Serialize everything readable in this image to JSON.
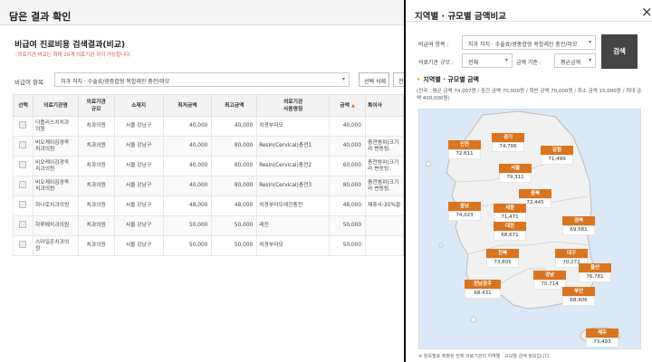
{
  "left": {
    "title": "담은 결과 확인",
    "close": "×",
    "section_title": "비급여 진료비용 검색결과(비교)",
    "note": "· 의료기관 비교는 최대 20개 의료기관 까지 가능합니다.",
    "filter_label": "비급여 항목",
    "filter_value": "치과 처치 · 수술료/광중합형 복합레진 충전/마모",
    "btn_delete": "선택 삭제",
    "btn_cut": "전",
    "columns": [
      "선택",
      "의료기관명",
      "의료기관\n규모",
      "소재지",
      "최저금액",
      "최고금액",
      "의료기관\n사용명칭",
      "금액",
      "특이사"
    ],
    "sort_icon": "▲",
    "rows": [
      {
        "name": "더플러스치치과\n의원",
        "scale": "치과의원",
        "loc": "서울 강남구",
        "min": "40,000",
        "max": "40,000",
        "usage": "치경부마모",
        "amount": "40,000",
        "remark": ""
      },
      {
        "name": "비오케이김광욱\n치과의원",
        "scale": "치과의원",
        "loc": "서울 강남구",
        "min": "40,000",
        "max": "80,000",
        "usage": "Resin(Cervical)충전1",
        "amount": "40,000",
        "remark": "충전범위(크기\n라 변동됨."
      },
      {
        "name": "비오케이김광욱\n치과의원",
        "scale": "치과의원",
        "loc": "서울 강남구",
        "min": "40,000",
        "max": "80,000",
        "usage": "Resin(Cervical)충전2",
        "amount": "60,000",
        "remark": "충전범위(크기\n라 변동됨."
      },
      {
        "name": "비오케이김광욱\n치과의원",
        "scale": "치과의원",
        "loc": "서울 강남구",
        "min": "40,000",
        "max": "80,000",
        "usage": "Resin(Cervical)충전3",
        "amount": "80,000",
        "remark": "충전범위(크기\n라 변동됨."
      },
      {
        "name": "하나로치과의원",
        "scale": "치과의원",
        "loc": "서울 강남구",
        "min": "48,000",
        "max": "48,000",
        "usage": "치경부마모레진충전",
        "amount": "48,000",
        "remark": "제휴사-20%할"
      },
      {
        "name": "하루에치과의원",
        "scale": "치과의원",
        "loc": "서울 강남구",
        "min": "50,000",
        "max": "50,000",
        "usage": "레진",
        "amount": "50,000",
        "remark": ""
      },
      {
        "name": "스마일존치과의\n원",
        "scale": "치과의원",
        "loc": "서울 강남구",
        "min": "50,000",
        "max": "50,000",
        "usage": "치경부마모",
        "amount": "50,000",
        "remark": ""
      }
    ]
  },
  "right": {
    "title": "지역별 · 규모별 금액비교",
    "close": "×",
    "item_label": "비급여 항목 :",
    "item_value": "치과 처치 · 수술료/광중합형 복합레진 충전/마모",
    "scale_label": "의료기관 규모 :",
    "scale_value": "전체",
    "amount_label": "금액 기준 :",
    "amount_value": "평균금액",
    "search": "검색",
    "sub_title": "지역별 · 규모별 금액",
    "desc": "(전국 : 평균 금액 74,007원 / 중간 금액 70,000원 / 최빈 금액 70,000원 / 최소 금액 15,000원 / 최대 금액 400,000원)",
    "regions": [
      {
        "name": "인천",
        "value": "72,611"
      },
      {
        "name": "경기",
        "value": "74,706"
      },
      {
        "name": "강원",
        "value": "71,499"
      },
      {
        "name": "서울",
        "value": "79,311"
      },
      {
        "name": "충북",
        "value": "72,445"
      },
      {
        "name": "충남",
        "value": "74,023"
      },
      {
        "name": "세종",
        "value": "71,471"
      },
      {
        "name": "대전",
        "value": "68,671"
      },
      {
        "name": "경북",
        "value": "69,581"
      },
      {
        "name": "대구",
        "value": "70,272"
      },
      {
        "name": "전북",
        "value": "73,805"
      },
      {
        "name": "울산",
        "value": "76,781"
      },
      {
        "name": "경남",
        "value": "70,714"
      },
      {
        "name": "전남광주",
        "value": "68,431"
      },
      {
        "name": "부산",
        "value": "68,406"
      },
      {
        "name": "제주",
        "value": "73,493"
      }
    ],
    "footnote": "※ 항목별로 제출된 전체 의료기관의 지역별 · 규모별 금액 정보입니다."
  },
  "colors": {
    "accent": "#d9741f",
    "map_bg": "#dbe8f6",
    "land": "#f1f1f1",
    "search_btn": "#444444"
  }
}
